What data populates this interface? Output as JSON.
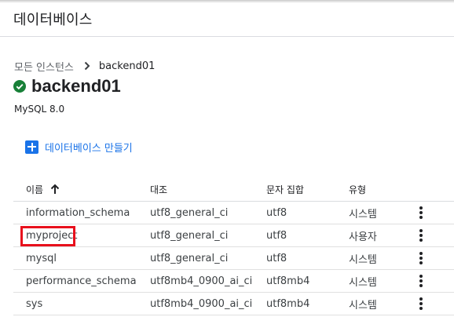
{
  "header": {
    "title": "데이터베이스"
  },
  "breadcrumb": {
    "parent": "모든 인스턴스",
    "current": "backend01"
  },
  "instance": {
    "name": "backend01",
    "version": "MySQL 8.0",
    "status_icon": "check-circle-icon",
    "status_color": "#188038"
  },
  "actions": {
    "create_label": "데이터베이스 만들기",
    "accent": "#1a73e8"
  },
  "table": {
    "columns": [
      "이름",
      "대조",
      "문자 집합",
      "유형"
    ],
    "sort_column": "이름",
    "rows": [
      {
        "name": "information_schema",
        "collation": "utf8_general_ci",
        "charset": "utf8",
        "type": "시스템"
      },
      {
        "name": "myproject",
        "collation": "utf8_general_ci",
        "charset": "utf8",
        "type": "사용자"
      },
      {
        "name": "mysql",
        "collation": "utf8_general_ci",
        "charset": "utf8",
        "type": "시스템"
      },
      {
        "name": "performance_schema",
        "collation": "utf8mb4_0900_ai_ci",
        "charset": "utf8mb4",
        "type": "시스템"
      },
      {
        "name": "sys",
        "collation": "utf8mb4_0900_ai_ci",
        "charset": "utf8mb4",
        "type": "시스템"
      }
    ]
  },
  "highlight": {
    "color": "#e8101c",
    "target": "myproject"
  }
}
